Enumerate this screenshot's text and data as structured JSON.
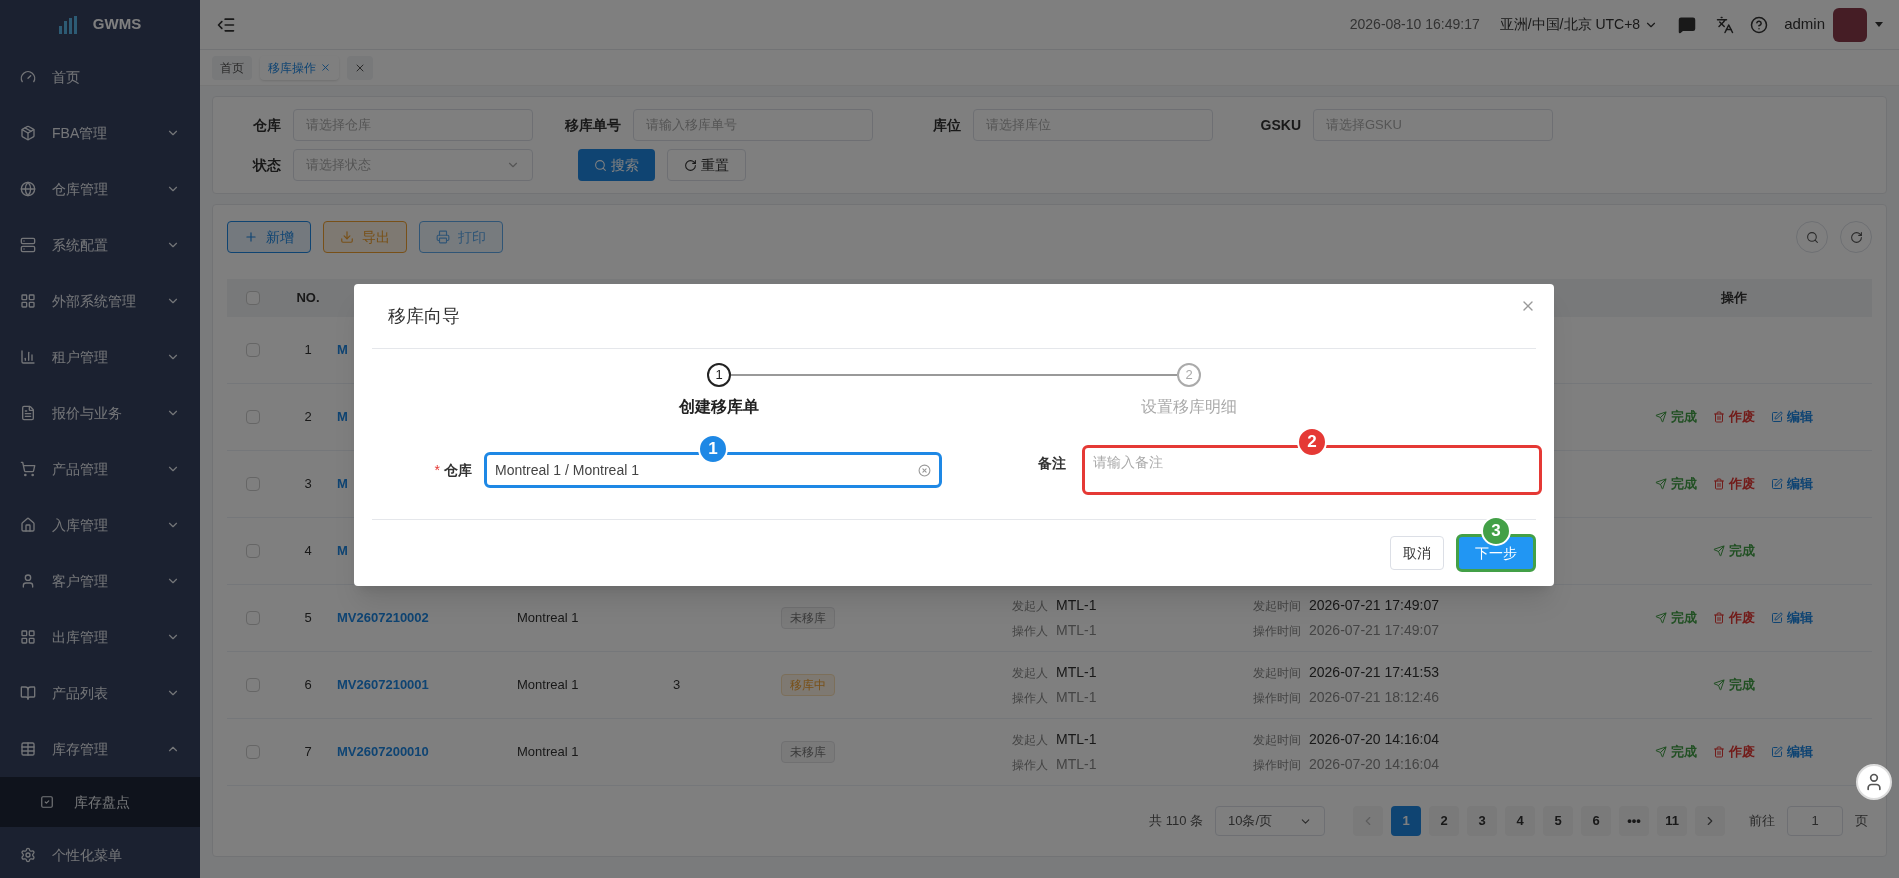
{
  "sidebar": {
    "logo": "GWMS",
    "items": [
      {
        "label": "首页",
        "kind": "link"
      },
      {
        "label": "FBA管理",
        "kind": "group",
        "expanded": false
      },
      {
        "label": "仓库管理",
        "kind": "group",
        "expanded": false
      },
      {
        "label": "系统配置",
        "kind": "group",
        "expanded": false
      },
      {
        "label": "外部系统管理",
        "kind": "group",
        "expanded": false
      },
      {
        "label": "租户管理",
        "kind": "group",
        "expanded": false
      },
      {
        "label": "报价与业务",
        "kind": "group",
        "expanded": false
      },
      {
        "label": "产品管理",
        "kind": "group",
        "expanded": false
      },
      {
        "label": "入库管理",
        "kind": "group",
        "expanded": false
      },
      {
        "label": "客户管理",
        "kind": "group",
        "expanded": false
      },
      {
        "label": "出库管理",
        "kind": "group",
        "expanded": false
      },
      {
        "label": "产品列表",
        "kind": "group",
        "expanded": false
      },
      {
        "label": "库存管理",
        "kind": "group",
        "expanded": true,
        "children": [
          {
            "label": "库存盘点",
            "selected": true
          }
        ]
      },
      {
        "label": "个性化菜单",
        "kind": "link"
      }
    ]
  },
  "header": {
    "datetime": "2026-08-10 16:49:17",
    "timezone": "亚洲/中国/北京 UTC+8",
    "user": "admin"
  },
  "tabs": [
    {
      "label": "首页",
      "selected": false,
      "closable": false
    },
    {
      "label": "移库操作",
      "selected": true,
      "closable": true
    }
  ],
  "filters": [
    {
      "label": "仓库",
      "placeholder": "请选择仓库",
      "kind": "input"
    },
    {
      "label": "移库单号",
      "placeholder": "请输入移库单号",
      "kind": "input"
    },
    {
      "label": "库位",
      "placeholder": "请选择库位",
      "kind": "input"
    },
    {
      "label": "GSKU",
      "placeholder": "请选择GSKU",
      "kind": "input"
    },
    {
      "label": "状态",
      "placeholder": "请选择状态",
      "kind": "select"
    }
  ],
  "filter_buttons": {
    "search": "搜索",
    "reset": "重置"
  },
  "toolbar": [
    {
      "label": "新增",
      "kind": "add",
      "disabled": false
    },
    {
      "label": "导出",
      "kind": "export",
      "disabled": false
    },
    {
      "label": "打印",
      "kind": "print",
      "disabled": true
    }
  ],
  "table": {
    "columns": [
      "NO.",
      "操作"
    ],
    "all_checked": false,
    "rows": [
      {
        "no": "1",
        "checked": false,
        "order": "M",
        "actions": []
      },
      {
        "no": "2",
        "checked": false,
        "order": "M",
        "actions": [
          {
            "label": "完成",
            "kind": "complete"
          },
          {
            "label": "作废",
            "kind": "void"
          },
          {
            "label": "编辑",
            "kind": "edit"
          }
        ]
      },
      {
        "no": "3",
        "checked": false,
        "order": "M",
        "actions": [
          {
            "label": "完成",
            "kind": "complete"
          },
          {
            "label": "作废",
            "kind": "void"
          },
          {
            "label": "编辑",
            "kind": "edit"
          }
        ]
      },
      {
        "no": "4",
        "checked": false,
        "order": "M",
        "actions": [
          {
            "label": "完成",
            "kind": "complete"
          }
        ]
      },
      {
        "no": "5",
        "checked": false,
        "order": "MV2607210002",
        "warehouse": "Montreal 1",
        "status": {
          "label": "未移库",
          "kind": "pending"
        },
        "initiator_label": "发起人",
        "initiator": "MTL-1",
        "operator_label": "操作人",
        "operator": "MTL-1",
        "start_label": "发起时间",
        "start": "2026-07-21 17:49:07",
        "op_label": "操作时间",
        "op_time": "2026-07-21 17:49:07",
        "actions": [
          {
            "label": "完成",
            "kind": "complete"
          },
          {
            "label": "作废",
            "kind": "void"
          },
          {
            "label": "编辑",
            "kind": "edit"
          }
        ]
      },
      {
        "no": "6",
        "checked": false,
        "order": "MV2607210001",
        "warehouse": "Montreal 1",
        "qty": "3",
        "status": {
          "label": "移库中",
          "kind": "moving"
        },
        "initiator_label": "发起人",
        "initiator": "MTL-1",
        "operator_label": "操作人",
        "operator": "MTL-1",
        "start_label": "发起时间",
        "start": "2026-07-21 17:41:53",
        "op_label": "操作时间",
        "op_time": "2026-07-21 18:12:46",
        "actions": [
          {
            "label": "完成",
            "kind": "complete"
          }
        ]
      },
      {
        "no": "7",
        "checked": false,
        "order": "MV2607200010",
        "warehouse": "Montreal 1",
        "status": {
          "label": "未移库",
          "kind": "pending"
        },
        "initiator_label": "发起人",
        "initiator": "MTL-1",
        "operator_label": "操作人",
        "operator": "MTL-1",
        "start_label": "发起时间",
        "start": "2026-07-20 14:16:04",
        "op_label": "操作时间",
        "op_time": "2026-07-20 14:16:04",
        "actions": [
          {
            "label": "完成",
            "kind": "complete"
          },
          {
            "label": "作废",
            "kind": "void"
          },
          {
            "label": "编辑",
            "kind": "edit"
          }
        ]
      }
    ]
  },
  "pagination": {
    "total": "共 110 条",
    "page_size": "10条/页",
    "pages": [
      {
        "label": "1",
        "selected": true
      },
      {
        "label": "2",
        "selected": false
      },
      {
        "label": "3",
        "selected": false
      },
      {
        "label": "4",
        "selected": false
      },
      {
        "label": "5",
        "selected": false
      },
      {
        "label": "6",
        "selected": false
      },
      {
        "label": "•••",
        "selected": false
      },
      {
        "label": "11",
        "selected": false
      }
    ],
    "goto_label": "前往",
    "goto_value": "1",
    "goto_suffix": "页"
  },
  "modal": {
    "title": "移库向导",
    "steps": [
      {
        "number": "1",
        "label": "创建移库单",
        "selected": true
      },
      {
        "number": "2",
        "label": "设置移库明细",
        "selected": false
      }
    ],
    "warehouse_field": {
      "label": "仓库",
      "required_mark": "*",
      "value": "Montreal 1 / Montreal 1"
    },
    "remark_field": {
      "label": "备注",
      "placeholder": "请输入备注"
    },
    "cancel": "取消",
    "next": "下一步",
    "annotations": [
      {
        "label": "1",
        "color": "#1e88e5"
      },
      {
        "label": "2",
        "color": "#e53935"
      },
      {
        "label": "3",
        "color": "#43a047"
      }
    ]
  }
}
